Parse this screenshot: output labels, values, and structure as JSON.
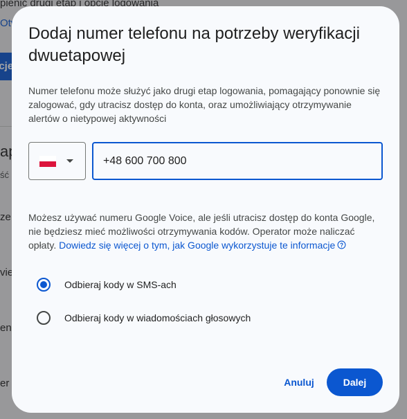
{
  "background": {
    "line1": "pienić drugi etap i opcje logowania",
    "link": "Otw",
    "button": "acje",
    "heading": "ap",
    "items": [
      "ść",
      "ze",
      "vien",
      "en",
      "er"
    ]
  },
  "dialog": {
    "title": "Dodaj numer telefonu na potrzeby weryfikacji dwuetapowej",
    "description": "Numer telefonu może służyć jako drugi etap logowania, pomagający ponownie się zalogować, gdy utracisz dostęp do konta, oraz umożliwiający otrzymywanie alertów o nietypowej aktywności",
    "country": {
      "flag_icon": "poland-flag-icon",
      "flag_colors": [
        "#ffffff",
        "#dc143c"
      ],
      "caret_icon": "arrow-drop-down-icon"
    },
    "phone_value": "+48 600 700 800",
    "info_text": "Możesz używać numeru Google Voice, ale jeśli utracisz dostęp do konta Google, nie będziesz mieć możliwości otrzymywania kodów. Operator może naliczać opłaty.",
    "info_link": "Dowiedz się więcej o tym, jak Google wykorzystuje te informacje",
    "help_icon": "help-circle-icon",
    "options": [
      {
        "label": "Odbieraj kody w SMS-ach",
        "checked": true
      },
      {
        "label": "Odbieraj kody w wiadomościach głosowych",
        "checked": false
      }
    ],
    "cancel_label": "Anuluj",
    "next_label": "Dalej"
  },
  "colors": {
    "accent": "#0b57d0",
    "dialog_bg": "#f8fafd",
    "text": "#1f1f1f",
    "muted_text": "#444746"
  }
}
